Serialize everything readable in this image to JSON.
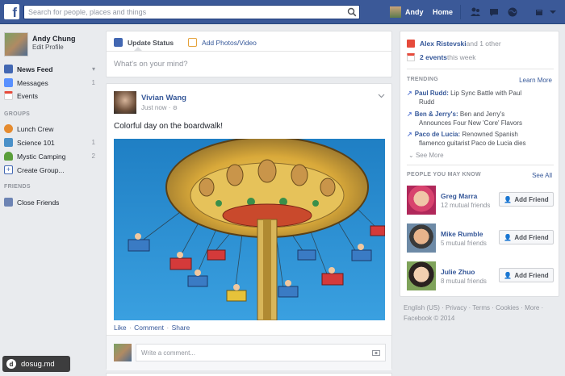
{
  "topbar": {
    "logo": "f",
    "search_placeholder": "Search for people, places and things",
    "user_name": "Andy",
    "home": "Home"
  },
  "left": {
    "profile_name": "Andy Chung",
    "edit_profile": "Edit Profile",
    "nav": [
      {
        "label": "News Feed",
        "count": "▾"
      },
      {
        "label": "Messages",
        "count": "1"
      },
      {
        "label": "Events",
        "count": ""
      }
    ],
    "groups_header": "GROUPS",
    "groups": [
      {
        "label": "Lunch Crew",
        "count": ""
      },
      {
        "label": "Science 101",
        "count": "1"
      },
      {
        "label": "Mystic Camping",
        "count": "2"
      },
      {
        "label": "Create Group...",
        "count": ""
      }
    ],
    "friends_header": "FRIENDS",
    "friends": [
      {
        "label": "Close Friends"
      }
    ]
  },
  "composer": {
    "tab_status": "Update Status",
    "tab_photo": "Add Photos/Video",
    "prompt": "What's on your mind?"
  },
  "post": {
    "author": "Vivian Wang",
    "time": "Just now · ",
    "text": "Colorful day on the boardwalk!",
    "like": "Like",
    "comment": "Comment",
    "share": "Share",
    "dot": " · ",
    "comment_placeholder": "Write a comment..."
  },
  "right": {
    "birthday_name": "Alex Ristevski",
    "birthday_rest": " and 1 other",
    "events_count": "2 events",
    "events_rest": " this week",
    "trending_header": "TRENDING",
    "learn_more": "Learn More",
    "trends": [
      {
        "name": "Paul Rudd:",
        "text": " Lip Sync Battle with Paul",
        "cont": "Rudd"
      },
      {
        "name": "Ben & Jerry's:",
        "text": " Ben and Jerry's",
        "cont": "Announces Four New 'Core' Flavors"
      },
      {
        "name": "Paco de Lucia:",
        "text": " Renowned Spanish",
        "cont": "flamenco guitarist Paco de Lucia dies"
      }
    ],
    "see_more": "See More",
    "pymk_header": "PEOPLE YOU MAY KNOW",
    "see_all": "See All",
    "people": [
      {
        "name": "Greg Marra",
        "mutual": "12 mutual friends",
        "button": "Add Friend"
      },
      {
        "name": "Mike Rumble",
        "mutual": "5 mutual friends",
        "button": "Add Friend"
      },
      {
        "name": "Julie Zhuo",
        "mutual": "8 mutual friends",
        "button": "Add Friend"
      }
    ]
  },
  "footer": {
    "line1": "English (US) · Privacy · Terms · Cookies · More ·",
    "line2": "Facebook © 2014"
  },
  "watermark": "dosug.md",
  "colors": {
    "brand": "#3b5998",
    "link": "#365899",
    "background": "#e9ebee"
  }
}
